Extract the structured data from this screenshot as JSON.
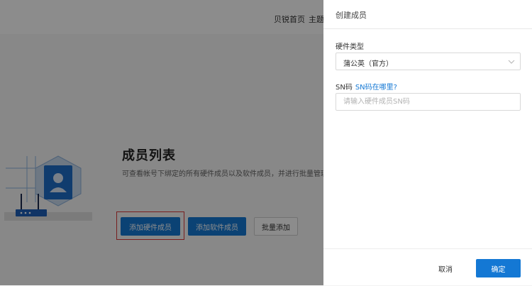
{
  "topbar": {
    "nav_home": "贝锐首页",
    "nav_theme": "主题管"
  },
  "main": {
    "title": "成员列表",
    "description": "可查看帐号下绑定的所有硬件成员以及软件成员，并进行批量管理",
    "buttons": {
      "add_hardware": "添加硬件成员",
      "add_software": "添加软件成员",
      "batch_add": "批量添加"
    }
  },
  "drawer": {
    "title": "创建成员",
    "hardware_type_label": "硬件类型",
    "hardware_type_value": "蒲公英（官方）",
    "sn_label": "SN码",
    "sn_help_link": "SN码在哪里?",
    "sn_placeholder": "请输入硬件成员SN码",
    "cancel_label": "取消",
    "confirm_label": "确定"
  },
  "colors": {
    "primary": "#1478d4",
    "highlight_border": "#d93a3a",
    "mask": "rgba(0,0,0,0.45)"
  },
  "icons": {
    "illustration": "member-illustration-icon",
    "select_arrow": "chevron-down-icon"
  }
}
